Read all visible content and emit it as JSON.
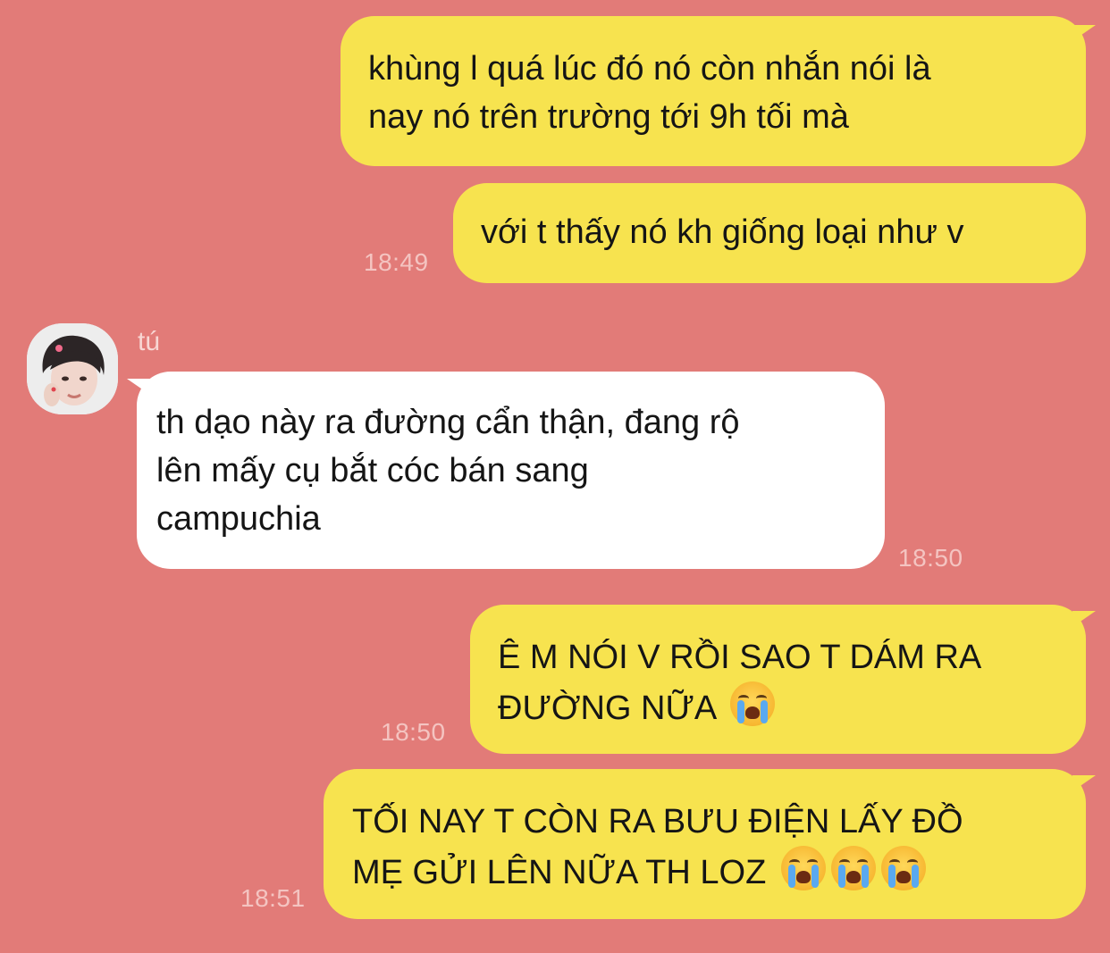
{
  "chat": {
    "messages": [
      {
        "direction": "outgoing",
        "lines": [
          "khùng l quá lúc đó nó còn nhắn nói là",
          "nay nó trên trường tới 9h tối mà"
        ],
        "time": ""
      },
      {
        "direction": "outgoing",
        "lines": [
          "với t thấy nó kh giống loại như v"
        ],
        "time": "18:49"
      },
      {
        "direction": "incoming",
        "sender": "tú",
        "lines": [
          "th dạo này ra đường cẩn thận, đang rộ",
          "lên mấy cụ bắt cóc bán sang",
          "campuchia"
        ],
        "time": "18:50"
      },
      {
        "direction": "outgoing",
        "lines": [
          "Ê M NÓI V RỒI SAO T DÁM RA",
          "ĐƯỜNG NỮA"
        ],
        "emoji": [
          "loudly-crying-face"
        ],
        "time": "18:50"
      },
      {
        "direction": "outgoing",
        "lines": [
          "TỐI NAY T CÒN RA BƯU ĐIỆN LẤY ĐỒ",
          "MẸ GỬI LÊN NỮA TH LOZ"
        ],
        "emoji": [
          "loudly-crying-face",
          "loudly-crying-face",
          "loudly-crying-face"
        ],
        "time": "18:51"
      }
    ]
  },
  "colors": {
    "background": "#e27b78",
    "outgoing_bubble": "#f7e34f",
    "incoming_bubble": "#ffffff",
    "timestamp": "#f4c4c1"
  }
}
